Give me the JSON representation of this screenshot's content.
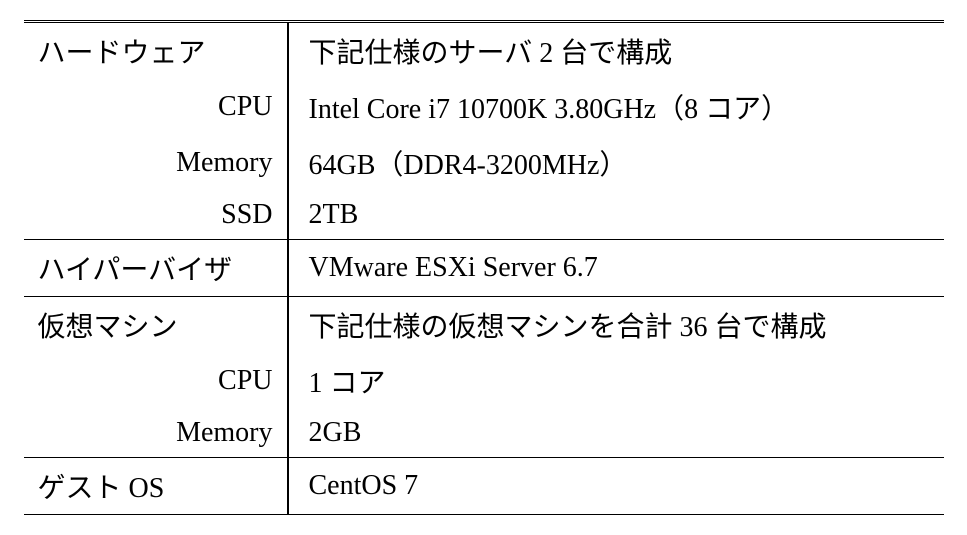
{
  "rows": [
    {
      "label": "ハードウェア",
      "value": "下記仕様のサーバ 2 台で構成",
      "leftAlign": true,
      "topBorder": false
    },
    {
      "label": "CPU",
      "value": "Intel Core i7 10700K 3.80GHz（8 コア）",
      "leftAlign": false,
      "topBorder": false
    },
    {
      "label": "Memory",
      "value": "64GB（DDR4-3200MHz）",
      "leftAlign": false,
      "topBorder": false
    },
    {
      "label": "SSD",
      "value": "2TB",
      "leftAlign": false,
      "topBorder": false
    },
    {
      "label": "ハイパーバイザ",
      "value": "VMware ESXi Server 6.7",
      "leftAlign": true,
      "topBorder": true
    },
    {
      "label": "仮想マシン",
      "value": "下記仕様の仮想マシンを合計 36 台で構成",
      "leftAlign": true,
      "topBorder": true
    },
    {
      "label": "CPU",
      "value": "1 コア",
      "leftAlign": false,
      "topBorder": false
    },
    {
      "label": "Memory",
      "value": "2GB",
      "leftAlign": false,
      "topBorder": false
    },
    {
      "label": "ゲスト OS",
      "value": "CentOS 7",
      "leftAlign": true,
      "topBorder": true
    }
  ]
}
